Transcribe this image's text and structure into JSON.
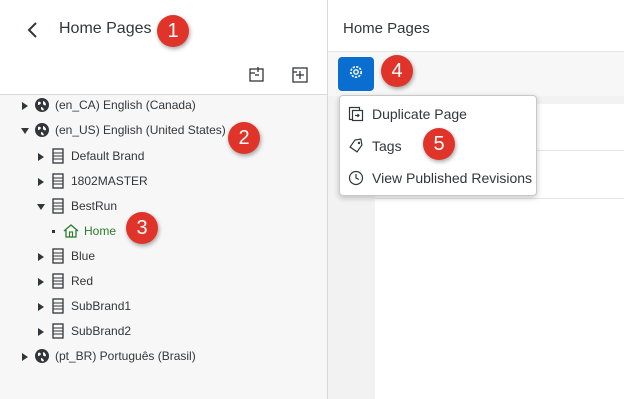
{
  "left_panel": {
    "title": "Home Pages"
  },
  "tree": {
    "items": [
      {
        "label": "(en_CA) English (Canada)"
      },
      {
        "label": "(en_US) English (United States)"
      },
      {
        "label": "Default Brand"
      },
      {
        "label": "1802MASTER"
      },
      {
        "label": "BestRun"
      },
      {
        "label": "Home"
      },
      {
        "label": "Blue"
      },
      {
        "label": "Red"
      },
      {
        "label": "SubBrand1"
      },
      {
        "label": "SubBrand2"
      },
      {
        "label": "(pt_BR) Português (Brasil)"
      }
    ]
  },
  "right_panel": {
    "title": "Home Pages"
  },
  "menu": {
    "items": [
      {
        "label": "Duplicate Page",
        "icon": "duplicate-icon"
      },
      {
        "label": "Tags",
        "icon": "tag-icon"
      },
      {
        "label": "View Published Revisions",
        "icon": "clock-icon"
      }
    ]
  },
  "callouts": [
    "1",
    "2",
    "3",
    "4",
    "5"
  ],
  "colors": {
    "accent": "#0a6ed1",
    "callout": "#e0342b",
    "selected_home": "#2b7c2b"
  }
}
